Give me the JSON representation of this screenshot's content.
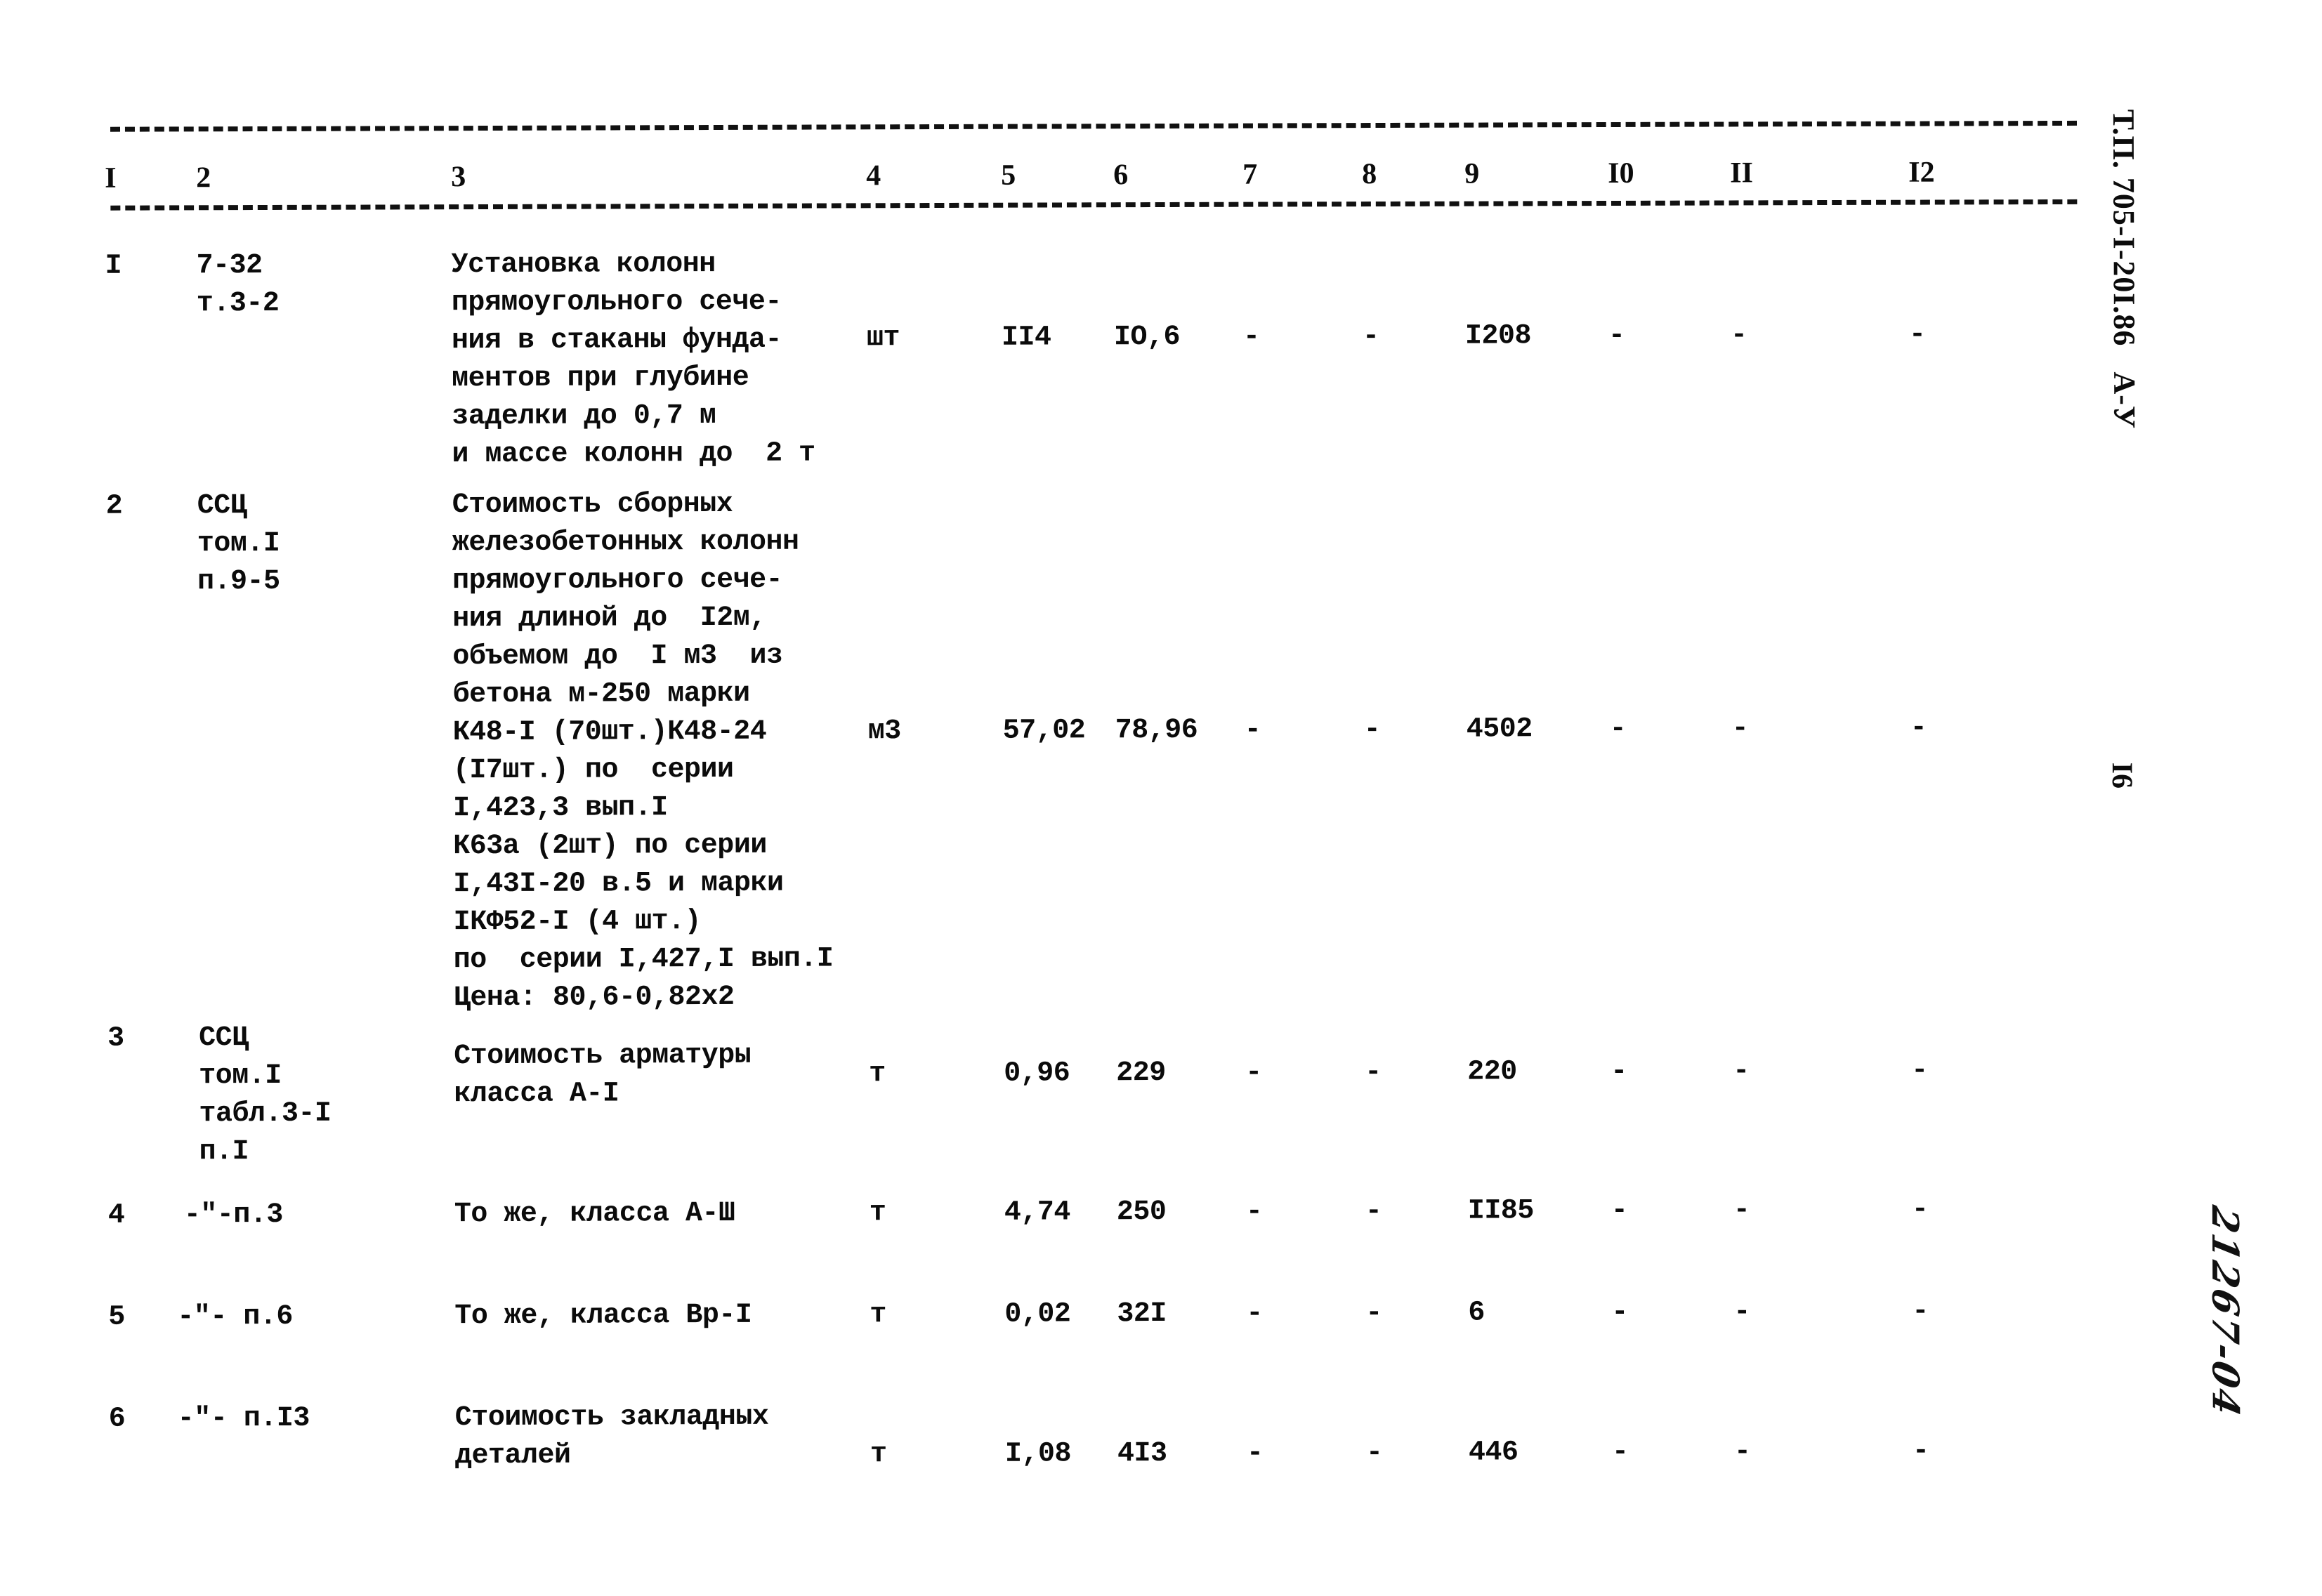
{
  "document": {
    "side_label": "Т.П. 705-I-20I.86   А-У",
    "page_number": "I6",
    "archive_mark": "21267-04"
  },
  "table": {
    "column_headers": [
      "I",
      "2",
      "3",
      "4",
      "5",
      "6",
      "7",
      "8",
      "9",
      "I0",
      "II",
      "I2"
    ],
    "rows": [
      {
        "no": "I",
        "justification": "7-32\nт.3-2",
        "description": "Установка колонн\nпрямоугольного сече-\nния в стаканы фунда-\nментов при глубине\nзаделки до 0,7 м\nи массе колонн до  2 т",
        "unit": "шт",
        "qty": "II4",
        "price": "IO,6",
        "c7": "-",
        "c8": "-",
        "total": "I208",
        "c10": "-",
        "c11": "-",
        "c12": "-"
      },
      {
        "no": "2",
        "justification": "ССЦ\nтом.I\nп.9-5",
        "description": "Стоимость сборных\nжелезобетонных колонн\nпрямоугольного сече-\nния длиной до  I2м,\nобъемом до  I м3  из\nбетона м-250 марки\nК48-I (70шт.)К48-24\n(I7шт.) по  серии\nI,423,3 вып.I\nК63а (2шт) по серии\nI,43I-20 в.5 и марки\nIКФ52-I (4 шт.)\nпо  серии I,427,I вып.I\nЦена: 80,6-0,82х2",
        "unit": "м3",
        "qty": "57,02",
        "price": "78,96",
        "c7": "-",
        "c8": "-",
        "total": "4502",
        "c10": "-",
        "c11": "-",
        "c12": "-"
      },
      {
        "no": "3",
        "justification": "ССЦ\nтом.I\nтабл.3-I\nп.I",
        "description": "Стоимость арматуры\nкласса А-I",
        "unit": "т",
        "qty": "0,96",
        "price": "229",
        "c7": "-",
        "c8": "-",
        "total": "220",
        "c10": "-",
        "c11": "-",
        "c12": "-"
      },
      {
        "no": "4",
        "justification": "-\"-п.3",
        "description": "То же, класса А-Ш",
        "unit": "т",
        "qty": "4,74",
        "price": "250",
        "c7": "-",
        "c8": "-",
        "total": "II85",
        "c10": "-",
        "c11": "-",
        "c12": "-"
      },
      {
        "no": "5",
        "justification": "-\"- п.6",
        "description": "То же, класса Вр-I",
        "unit": "т",
        "qty": "0,02",
        "price": "32I",
        "c7": "-",
        "c8": "-",
        "total": "6",
        "c10": "-",
        "c11": "-",
        "c12": "-"
      },
      {
        "no": "6",
        "justification": "-\"- п.I3",
        "description": "Стоимость закладных\nдеталей",
        "unit": "т",
        "qty": "I,08",
        "price": "4I3",
        "c7": "-",
        "c8": "-",
        "total": "446",
        "c10": "-",
        "c11": "-",
        "c12": "-"
      }
    ]
  }
}
